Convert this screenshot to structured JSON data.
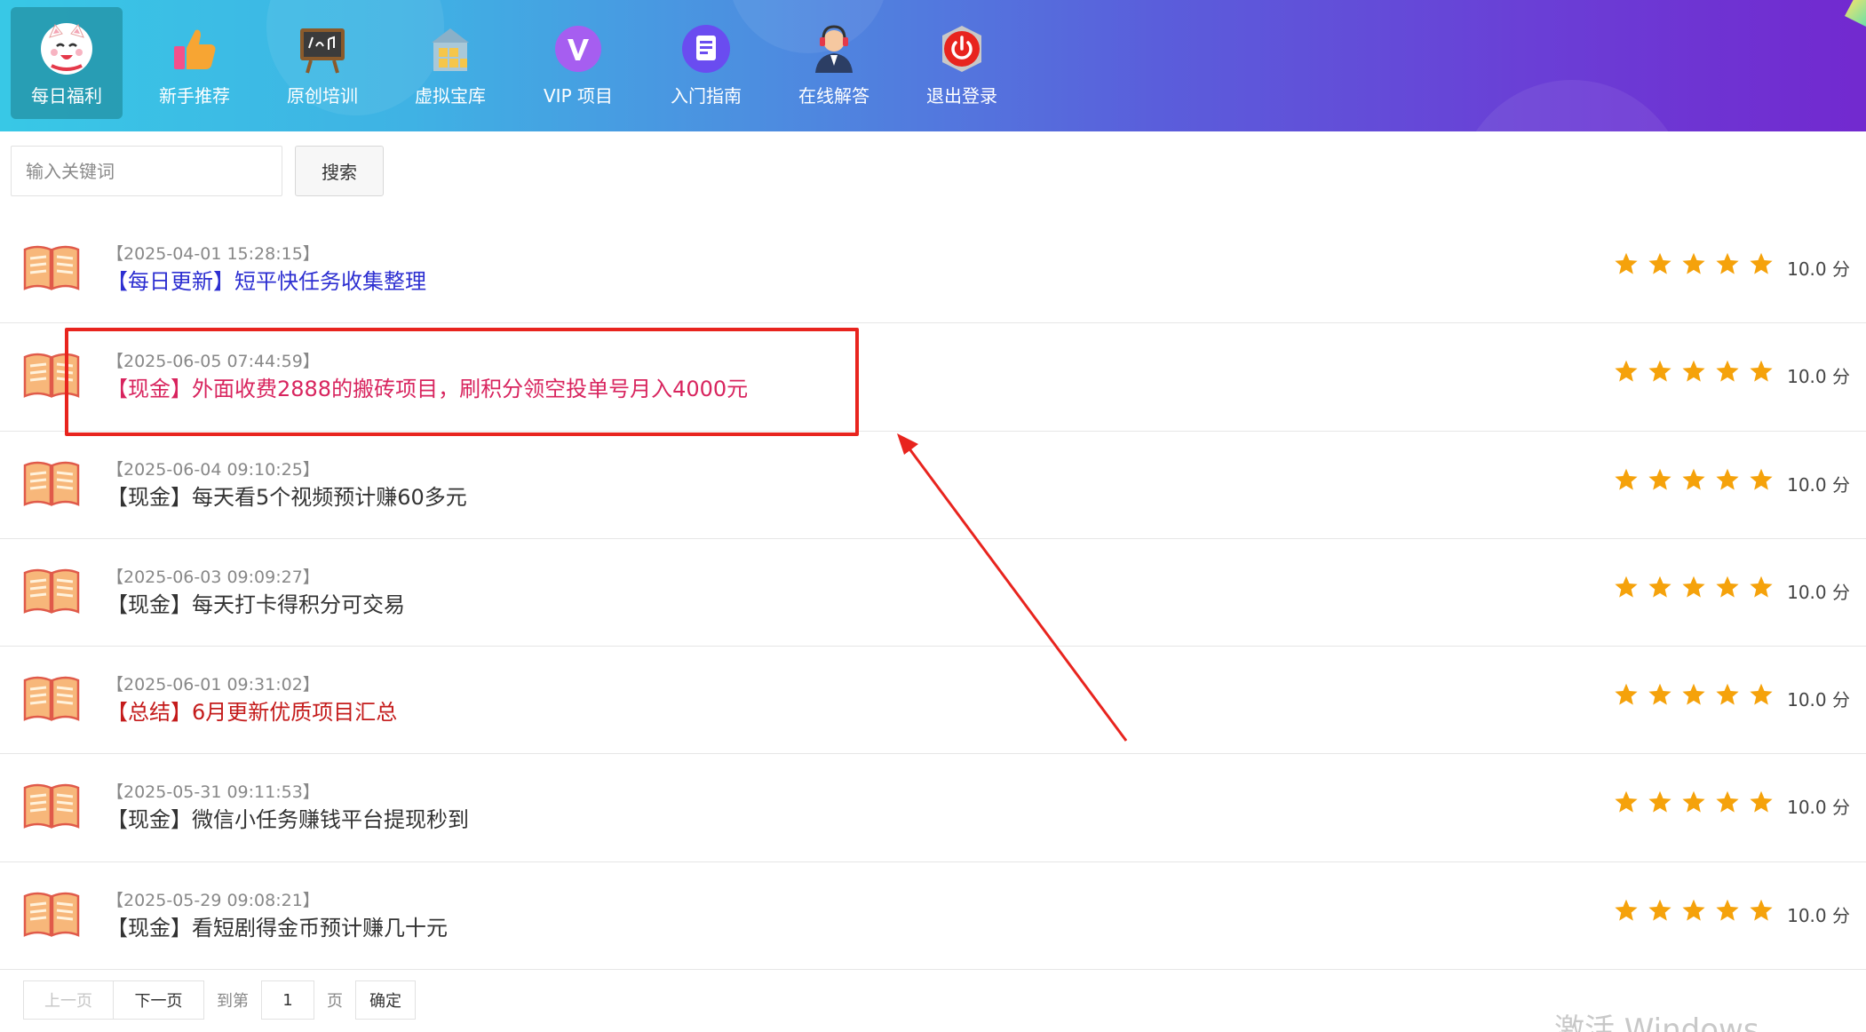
{
  "nav": {
    "items": [
      {
        "label": "每日福利",
        "icon": "lucky-cat-icon",
        "active": true
      },
      {
        "label": "新手推荐",
        "icon": "thumbs-up-icon"
      },
      {
        "label": "原创培训",
        "icon": "blackboard-icon"
      },
      {
        "label": "虚拟宝库",
        "icon": "treasure-box-icon"
      },
      {
        "label": "VIP 项目",
        "icon": "vip-badge-icon"
      },
      {
        "label": "入门指南",
        "icon": "guide-document-icon"
      },
      {
        "label": "在线解答",
        "icon": "customer-service-icon"
      },
      {
        "label": "退出登录",
        "icon": "power-off-icon"
      }
    ]
  },
  "search": {
    "placeholder": "输入关键词",
    "button_label": "搜索"
  },
  "colors": {
    "blue_title": "#2d2fd1",
    "pink_title": "#d8245e",
    "red_title": "#c41b1b",
    "black_title": "#333333",
    "star": "#f5a20b",
    "annotation": "#e8241e"
  },
  "list": {
    "items": [
      {
        "date": "【2025-04-01 15:28:15】",
        "title": "【每日更新】短平快任务收集整理",
        "score": "10.0 分",
        "rating": 5
      },
      {
        "date": "【2025-06-05 07:44:59】",
        "title": "【现金】外面收费2888的搬砖项目，刷积分领空投单号月入4000元",
        "score": "10.0 分",
        "rating": 5
      },
      {
        "date": "【2025-06-04 09:10:25】",
        "title": "【现金】每天看5个视频预计赚60多元",
        "score": "10.0 分",
        "rating": 5
      },
      {
        "date": "【2025-06-03 09:09:27】",
        "title": "【现金】每天打卡得积分可交易",
        "score": "10.0 分",
        "rating": 5
      },
      {
        "date": "【2025-06-01 09:31:02】",
        "title": "【总结】6月更新优质项目汇总",
        "score": "10.0 分",
        "rating": 5
      },
      {
        "date": "【2025-05-31 09:11:53】",
        "title": "【现金】微信小任务赚钱平台提现秒到",
        "score": "10.0 分",
        "rating": 5
      },
      {
        "date": "【2025-05-29 09:08:21】",
        "title": "【现金】看短剧得金币预计赚几十元",
        "score": "10.0 分",
        "rating": 5
      }
    ]
  },
  "pagination": {
    "prev": "上一页",
    "next": "下一页",
    "goto": "到第",
    "page_value": "1",
    "page_unit": "页",
    "confirm": "确定"
  },
  "watermark": "激活 Windows"
}
